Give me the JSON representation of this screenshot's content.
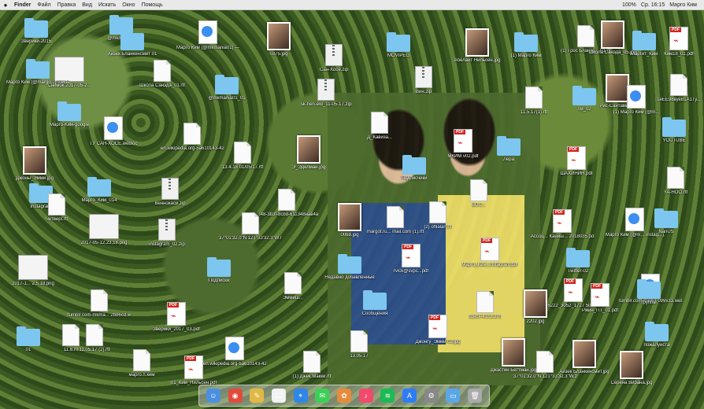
{
  "menubar": {
    "apple": "",
    "items": [
      "Finder",
      "Файл",
      "Правка",
      "Вид",
      "Искать",
      "Окно",
      "Помощь"
    ],
    "right": [
      "100%",
      "Ср. 16:15",
      "Марго Ким"
    ]
  },
  "icons": [
    {
      "type": "folder",
      "label": "Зверики-2015"
    },
    {
      "type": "folder",
      "label": "@mkmania..."
    },
    {
      "type": "folder",
      "label": "Айзек Бланкенсмит 01"
    },
    {
      "type": "web",
      "label": "Марго Ким (@mkmania01) — Twitter.webloc"
    },
    {
      "type": "image",
      "label": "0375.jpg"
    },
    {
      "type": "zip",
      "label": "Сан-Хосе.zip"
    },
    {
      "type": "folder",
      "label": "MOVIPEG"
    },
    {
      "type": "zip",
      "label": "Вин.zip"
    },
    {
      "type": "image",
      "label": "Абелайт Нильсен.jpg"
    },
    {
      "type": "folder",
      "label": "(1) Марго Ким"
    },
    {
      "type": "doc",
      "label": "(1) Грос Бланке... 01.rtf"
    },
    {
      "type": "image",
      "label": "Школа Санэда_05.jpg"
    },
    {
      "type": "folder",
      "label": "Маргит_Ким"
    },
    {
      "type": "pdf",
      "label": "Ким1п_01.pdf"
    },
    {
      "type": "shot",
      "label": "Снимок 2017-05-2..."
    },
    {
      "type": "folder",
      "label": "Марго Ким (@margo...) Twitter"
    },
    {
      "type": "doc",
      "label": "Школа Санэда_01.rtf"
    },
    {
      "type": "folder",
      "label": "@mkmania01_01"
    },
    {
      "type": "zip",
      "label": "sk-hen-eld_11-05-17.zip"
    },
    {
      "type": "doc",
      "label": "11.5.17(1).rtf"
    },
    {
      "type": "folder",
      "label": "Ли_02"
    },
    {
      "type": "image",
      "label": "Рис-Сантаман..."
    },
    {
      "type": "web",
      "label": "(1) Марго Ким (@m..."
    },
    {
      "type": "doc",
      "label": "1eEE98вуе81A1Ty..."
    },
    {
      "type": "folder",
      "label": "Марго-Ким-google"
    },
    {
      "type": "web",
      "label": "ТУ САН-ХОСЕ.webloc"
    },
    {
      "type": "doc",
      "label": "en.wikipedia.org-5a610143-4248-3b3f-8cbd.rtf"
    },
    {
      "type": "doc",
      "label": "13.4.18 01/05/17.rtf"
    },
    {
      "type": "image",
      "label": "Э_Эделман.jpg"
    },
    {
      "type": "doc",
      "label": "Д_Кавиза..."
    },
    {
      "type": "pdf",
      "label": "МКИМ v02.pdf"
    },
    {
      "type": "folder",
      "label": "Лера"
    },
    {
      "type": "pdf",
      "label": "ШАХИНИН.pdf"
    },
    {
      "type": "folder",
      "label": "YOUTUBE"
    },
    {
      "type": "image",
      "label": "Джоны_Эмми.jpg"
    },
    {
      "type": "folder",
      "label": "instagram"
    },
    {
      "type": "folder",
      "label": "Марго_Ким_014"
    },
    {
      "type": "zip",
      "label": "Веннокаси.zip"
    },
    {
      "type": "doc",
      "label": "4248-3b3f-8cbd-611348нав4a.rtf"
    },
    {
      "type": "folder",
      "label": "Подписчики"
    },
    {
      "type": "doc",
      "label": "(2) ohlalan.rtf"
    },
    {
      "type": "doc",
      "label": "ВОС..."
    },
    {
      "type": "pdf",
      "label": "Ассоц... Каниш... 2018035.pdf"
    },
    {
      "type": "web",
      "label": "Марго Ким (@m... instag...)"
    },
    {
      "type": "doc",
      "label": "YA-HOO.rtf"
    },
    {
      "type": "doc",
      "label": "Четверг.rtf"
    },
    {
      "type": "shot",
      "label": "2017-05-12,23,18.png"
    },
    {
      "type": "zip",
      "label": "instagram_02.zip"
    },
    {
      "type": "doc",
      "label": "37°01'32.0\"N 121°33'32.3\"W.rtf"
    },
    {
      "type": "image",
      "label": "0068.jpg"
    },
    {
      "type": "doc",
      "label": "margot.ru... mail.com (1).rtf"
    },
    {
      "type": "pdf",
      "label": "rvick@svpc...pdf"
    },
    {
      "type": "pdf",
      "label": "Марго_Ким_Instagram.pdf"
    },
    {
      "type": "folder",
      "label": "Twitter-02"
    },
    {
      "type": "folder",
      "label": "NanUS"
    },
    {
      "type": "shot",
      "label": "2017-1... 2.5.18.png"
    },
    {
      "type": "doc",
      "label": "tumblr.com-mkma... 2b86cd.webloc"
    },
    {
      "type": "folder",
      "label": "Подписки"
    },
    {
      "type": "doc",
      "label": "Эммиш..."
    },
    {
      "type": "folder",
      "label": "Недавно добавленные"
    },
    {
      "type": "pdf",
      "label": "P66222_3052_1727 50985879.pdf"
    },
    {
      "type": "web",
      "label": "tumblr.com-mkma 099x33.webloc"
    },
    {
      "type": "doc",
      "label": "11.05.17 (2).rtf"
    },
    {
      "type": "pdf",
      "label": "Зверики_2017_03.pdf"
    },
    {
      "type": "folder",
      "label": "Сообщения"
    },
    {
      "type": "doc",
      "label": "поиск-4.0.2.2.rtf"
    },
    {
      "type": "image",
      "label": "2202.jpg"
    },
    {
      "type": "pdf",
      "label": "Ржин_ПТ_01.pdf"
    },
    {
      "type": "folder",
      "label": "группы"
    },
    {
      "type": "folder",
      "label": "01"
    },
    {
      "type": "doc",
      "label": "11.6.rtf"
    },
    {
      "type": "web",
      "label": "en.wikipedia.org-5a610143-4248-3b3f-8 611348нав4a.webloc"
    },
    {
      "type": "doc",
      "label": "13.05.17"
    },
    {
      "type": "pdf",
      "label": "Джонгу_Эмми 02.jpg"
    },
    {
      "type": "image",
      "label": "Джастин Беттман.jpg"
    },
    {
      "type": "image",
      "label": "Айзек Бланкенсмит.jpg"
    },
    {
      "type": "folder",
      "label": "пожалуйста"
    },
    {
      "type": "doc",
      "label": "марго.п.ким"
    },
    {
      "type": "pdf",
      "label": "01_Ким_Нильсен.pdf"
    },
    {
      "type": "doc",
      "label": "(1) Джек Макки.rtf"
    },
    {
      "type": "doc",
      "label": "37°01'32.0\"N 121°33'32.3\"W.zip"
    },
    {
      "type": "image",
      "label": "Серена Вирана.jpg"
    }
  ],
  "dock": [
    "finder-icon",
    "chrome-icon",
    "notes-icon",
    "calendar-icon",
    "safari-icon",
    "messages-icon",
    "photos-icon",
    "music-icon",
    "spotify-icon",
    "appstore-icon",
    "settings-icon",
    "folder-icon",
    "trash-icon"
  ]
}
